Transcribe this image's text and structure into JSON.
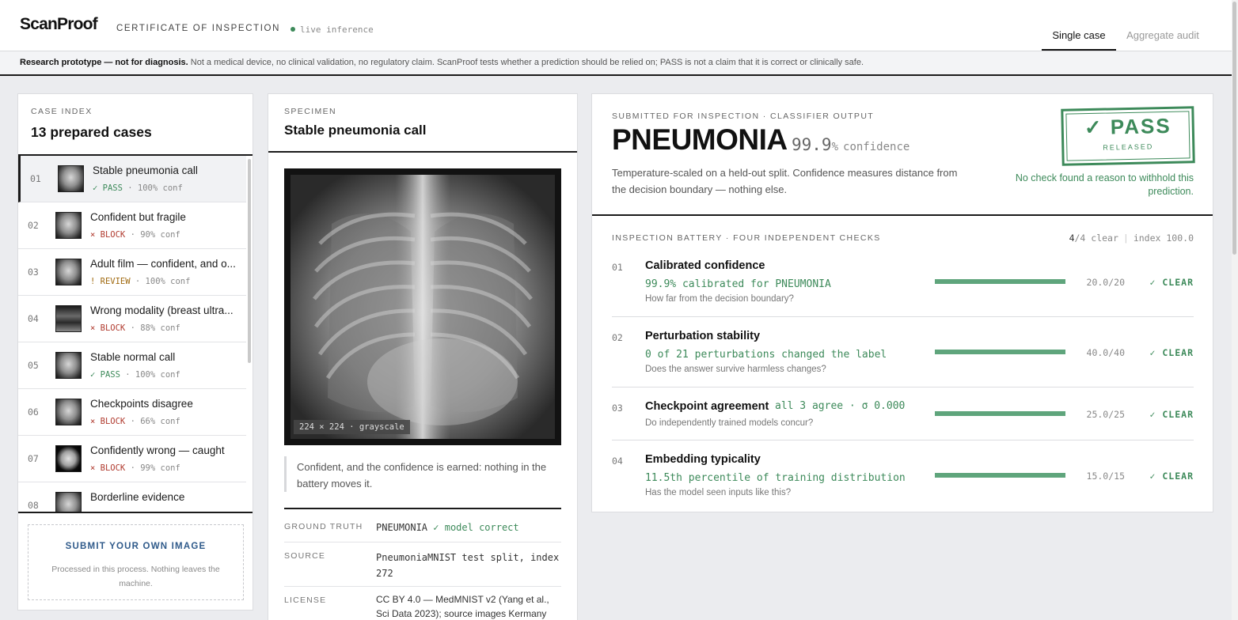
{
  "header": {
    "brand": "ScanProof",
    "subtitle": "CERTIFICATE OF INSPECTION",
    "live": "live inference",
    "tabs": [
      {
        "label": "Single case",
        "active": true
      },
      {
        "label": "Aggregate audit",
        "active": false
      }
    ]
  },
  "disclaimer": {
    "bold": "Research prototype — not for diagnosis.",
    "text": " Not a medical device, no clinical validation, no regulatory claim. ScanProof tests whether a prediction should be relied on; PASS is not a claim that it is correct or clinically safe."
  },
  "case_index": {
    "label": "CASE INDEX",
    "title": "13 prepared cases",
    "cases": [
      {
        "num": "01",
        "title": "Stable pneumonia call",
        "status": "✓ PASS",
        "kind": "pass",
        "conf": "· 100% conf",
        "active": true
      },
      {
        "num": "02",
        "title": "Confident but fragile",
        "status": "× BLOCK",
        "kind": "block",
        "conf": "· 90% conf",
        "active": false
      },
      {
        "num": "03",
        "title": "Adult film — confident, and o...",
        "status": "! REVIEW",
        "kind": "review",
        "conf": "· 100% conf",
        "active": false
      },
      {
        "num": "04",
        "title": "Wrong modality (breast ultra...",
        "status": "× BLOCK",
        "kind": "block",
        "conf": "· 88% conf",
        "active": false
      },
      {
        "num": "05",
        "title": "Stable normal call",
        "status": "✓ PASS",
        "kind": "pass",
        "conf": "· 100% conf",
        "active": false
      },
      {
        "num": "06",
        "title": "Checkpoints disagree",
        "status": "× BLOCK",
        "kind": "block",
        "conf": "· 66% conf",
        "active": false
      },
      {
        "num": "07",
        "title": "Confidently wrong — caught",
        "status": "× BLOCK",
        "kind": "block",
        "conf": "· 99% conf",
        "active": false
      },
      {
        "num": "08",
        "title": "Borderline evidence",
        "status": "",
        "kind": "review",
        "conf": "",
        "active": false
      }
    ],
    "upload": {
      "title": "SUBMIT YOUR OWN IMAGE",
      "note": "Processed in this process. Nothing leaves the machine."
    }
  },
  "specimen": {
    "label": "SPECIMEN",
    "title": "Stable pneumonia call",
    "image_caption": "224 × 224 · grayscale",
    "quote": "Confident, and the confidence is earned: nothing in the battery moves it.",
    "meta": [
      {
        "key": "GROUND TRUTH",
        "value": "PNEUMONIA",
        "extra": "✓ model correct"
      },
      {
        "key": "SOURCE",
        "value": "PneumoniaMNIST test split, index 272",
        "extra": ""
      },
      {
        "key": "LICENSE",
        "value": "CC BY 4.0 — MedMNIST v2 (Yang et al., Sci Data 2023); source images Kermany",
        "extra": ""
      }
    ]
  },
  "verdict": {
    "label": "SUBMITTED FOR INSPECTION · CLASSIFIER OUTPUT",
    "prediction": "PNEUMONIA",
    "confidence_value": "99.9",
    "confidence_unit": "%",
    "confidence_word": "confidence",
    "note": "Temperature-scaled on a held-out split. Confidence measures distance from the decision boundary — nothing else.",
    "stamp": "✓ PASS",
    "stamp_sub": "RELEASED",
    "ok_text": "No check found a reason to withhold this prediction."
  },
  "battery": {
    "label": "INSPECTION BATTERY · FOUR INDEPENDENT CHECKS",
    "clear_count": "4",
    "clear_total": "/4 clear",
    "index": "index 100.0",
    "checks": [
      {
        "num": "01",
        "name": "Calibrated confidence",
        "value": "99.9% calibrated for PNEUMONIA",
        "question": "How far from the decision boundary?",
        "score": "20.0/20",
        "fraction": 1.0,
        "status": "✓ CLEAR"
      },
      {
        "num": "02",
        "name": "Perturbation stability",
        "value": "0 of 21 perturbations changed the label",
        "question": "Does the answer survive harmless changes?",
        "score": "40.0/40",
        "fraction": 1.0,
        "status": "✓ CLEAR"
      },
      {
        "num": "03",
        "name": "Checkpoint agreement",
        "value": "all 3 agree · σ 0.000",
        "question": "Do independently trained models concur?",
        "score": "25.0/25",
        "fraction": 1.0,
        "status": "✓ CLEAR"
      },
      {
        "num": "04",
        "name": "Embedding typicality",
        "value": "11.5th percentile of training distribution",
        "question": "Has the model seen inputs like this?",
        "score": "15.0/15",
        "fraction": 1.0,
        "status": "✓ CLEAR"
      }
    ]
  },
  "colors": {
    "pass": "#3d8a5a",
    "block": "#b03a2e",
    "review": "#a06a10",
    "ink": "#1b1b1b"
  }
}
